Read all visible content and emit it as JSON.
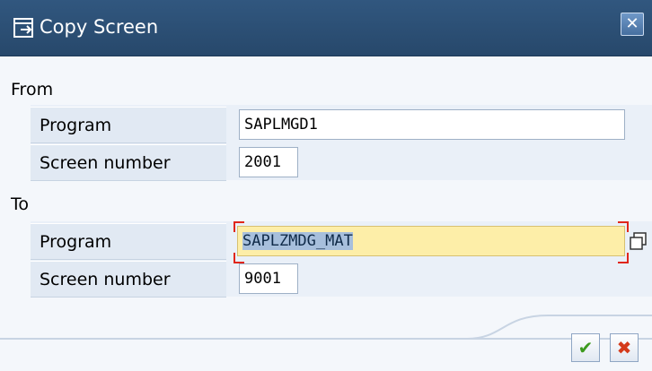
{
  "window": {
    "title": "Copy Screen",
    "close_symbol": "✕"
  },
  "from": {
    "heading": "From",
    "program_label": "Program",
    "program_value": "SAPLMGD1",
    "screen_label": "Screen number",
    "screen_value": "2001"
  },
  "to": {
    "heading": "To",
    "program_label": "Program",
    "program_value": "SAPLZMDG_MAT",
    "screen_label": "Screen number",
    "screen_value": "9001"
  },
  "buttons": {
    "confirm_symbol": "✔",
    "cancel_symbol": "✖"
  },
  "colors": {
    "titlebar": "#2b4e74",
    "required_field": "#fdeea8",
    "confirm": "#3c9a1e",
    "cancel": "#d43a1a"
  }
}
